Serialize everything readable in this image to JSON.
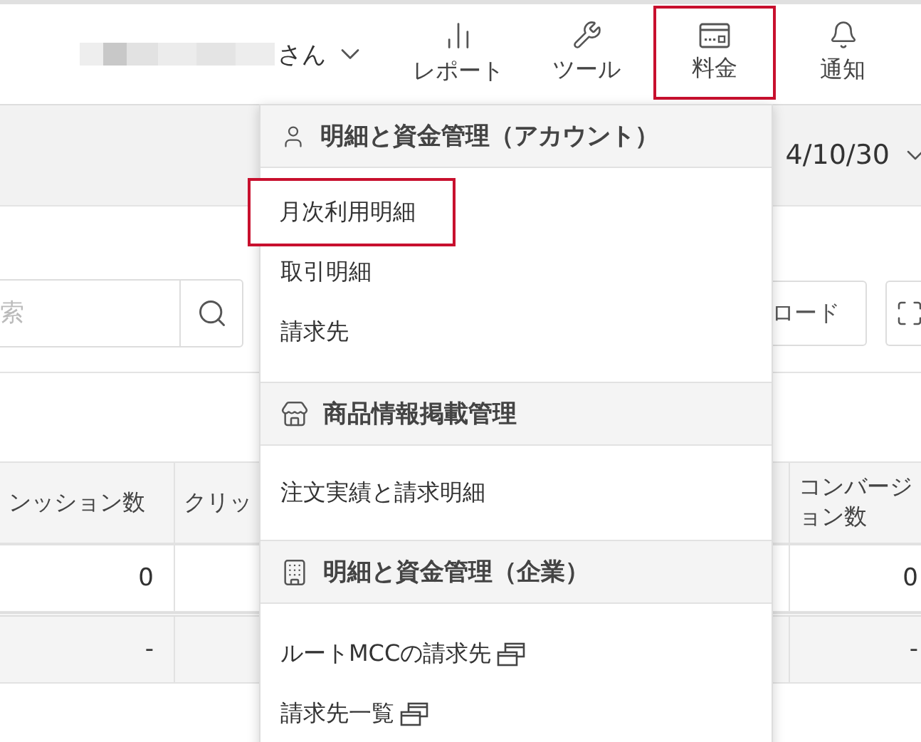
{
  "user": {
    "suffix": "さん"
  },
  "nav_items": [
    {
      "kind": "report",
      "label": "レポート",
      "highlighted": false
    },
    {
      "kind": "tools",
      "label": "ツール",
      "highlighted": false
    },
    {
      "kind": "billing",
      "label": "料金",
      "highlighted": true
    },
    {
      "kind": "notifications",
      "label": "通知",
      "highlighted": false
    }
  ],
  "date_range": {
    "value": "4/10/30"
  },
  "search": {
    "placeholder": "索"
  },
  "toolbar_buttons": [
    {
      "kind": "download",
      "label": "ロード"
    },
    {
      "kind": "expand"
    }
  ],
  "table": {
    "columns": [
      {
        "label": "ンッション数",
        "cells": [
          "0",
          "-"
        ]
      },
      {
        "label": "クリッ"
      },
      {
        "label": "コンバージョン数",
        "cells": [
          "0",
          "-"
        ]
      }
    ]
  },
  "menu": {
    "sections": [
      {
        "kind": "account",
        "title": "明細と資金管理（アカウント）",
        "items": [
          {
            "label": "月次利用明細",
            "highlighted": true,
            "external": false
          },
          {
            "label": "取引明細",
            "highlighted": false,
            "external": false
          },
          {
            "label": "請求先",
            "highlighted": false,
            "external": false
          }
        ]
      },
      {
        "kind": "store",
        "title": "商品情報掲載管理",
        "items": [
          {
            "label": "注文実績と請求明細",
            "highlighted": false,
            "external": false
          }
        ]
      },
      {
        "kind": "company",
        "title": "明細と資金管理（企業）",
        "items": [
          {
            "label": "ルートMCCの請求先",
            "highlighted": false,
            "external": true
          },
          {
            "label": "請求先一覧",
            "highlighted": false,
            "external": true
          }
        ]
      }
    ]
  }
}
